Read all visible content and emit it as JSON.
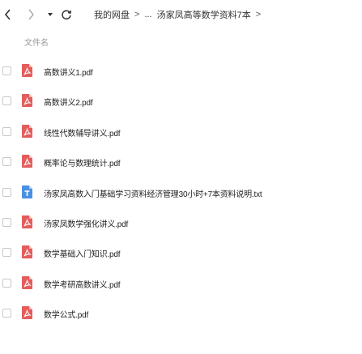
{
  "toolbar": {
    "back_icon": "chevron-left-icon",
    "forward_icon": "chevron-right-icon",
    "history_dropdown_icon": "caret-down-icon",
    "refresh_icon": "refresh-icon"
  },
  "breadcrumb": {
    "root": "我的网盘",
    "sep1": ">",
    "ellipsis": "...",
    "current": "汤家凤高等数学资料7本",
    "sep2": ">"
  },
  "list_header": {
    "name_column": "文件名"
  },
  "files": [
    {
      "name": "高数讲义1.pdf",
      "type": "pdf"
    },
    {
      "name": "高数讲义2.pdf",
      "type": "pdf"
    },
    {
      "name": "线性代数辅导讲义.pdf",
      "type": "pdf"
    },
    {
      "name": "概率论与数理统计.pdf",
      "type": "pdf"
    },
    {
      "name": "汤家凤高数入门基础学习资料经济管理30小时+7本资料说明.txt",
      "type": "txt"
    },
    {
      "name": "汤家凤数学强化讲义.pdf",
      "type": "pdf"
    },
    {
      "name": "数学基础入门知识.pdf",
      "type": "pdf"
    },
    {
      "name": "数学考研高数讲义.pdf",
      "type": "pdf"
    },
    {
      "name": "数学公式.pdf",
      "type": "pdf"
    }
  ],
  "colors": {
    "pdf_icon": "#e45c5c",
    "txt_icon": "#4a90e2"
  }
}
